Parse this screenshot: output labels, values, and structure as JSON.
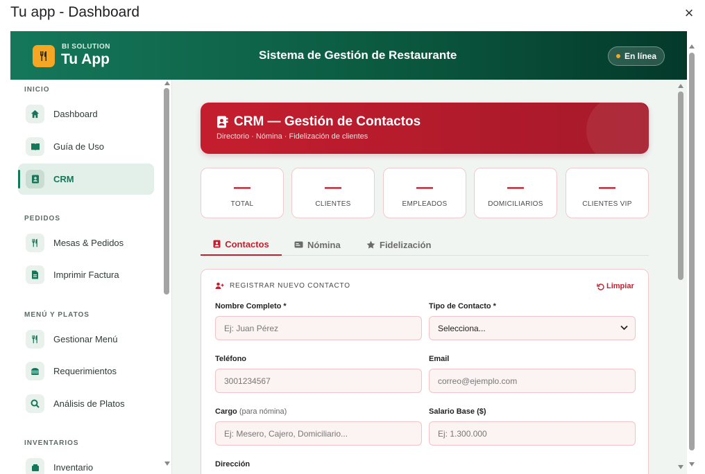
{
  "window": {
    "title": "Tu app - Dashboard",
    "close_icon": "×"
  },
  "header": {
    "brand_small": "BI SOLUTION",
    "brand_name": "Tu App",
    "title": "Sistema de Gestión de Restaurante",
    "status": "En línea"
  },
  "sidebar": {
    "sections": [
      "INICIO",
      "PEDIDOS",
      "MENÚ Y PLATOS",
      "INVENTARIOS"
    ],
    "items": [
      {
        "label": "Dashboard",
        "icon": "home-icon"
      },
      {
        "label": "Guía de Uso",
        "icon": "book-icon"
      },
      {
        "label": "CRM",
        "icon": "contact-card-icon"
      },
      {
        "label": "Mesas & Pedidos",
        "icon": "utensils-icon"
      },
      {
        "label": "Imprimir Factura",
        "icon": "document-icon"
      },
      {
        "label": "Gestionar Menú",
        "icon": "utensils-icon"
      },
      {
        "label": "Requerimientos",
        "icon": "burger-icon"
      },
      {
        "label": "Análisis de Platos",
        "icon": "magnify-icon"
      },
      {
        "label": "Inventario",
        "icon": "box-icon"
      }
    ]
  },
  "crm": {
    "title": "CRM — Gestión de Contactos",
    "subtitle": "Directorio · Nómina · Fidelización de clientes"
  },
  "stats": [
    {
      "value": "—",
      "label": "TOTAL"
    },
    {
      "value": "—",
      "label": "CLIENTES"
    },
    {
      "value": "—",
      "label": "EMPLEADOS"
    },
    {
      "value": "—",
      "label": "DOMICILIARIOS"
    },
    {
      "value": "—",
      "label": "CLIENTES VIP"
    }
  ],
  "tabs": [
    {
      "label": "Contactos",
      "active": true
    },
    {
      "label": "Nómina",
      "active": false
    },
    {
      "label": "Fidelización",
      "active": false
    }
  ],
  "form": {
    "section_title": "REGISTRAR NUEVO CONTACTO",
    "clear_label": "Limpiar",
    "fields": {
      "name": {
        "label": "Nombre Completo *",
        "placeholder": "Ej: Juan Pérez",
        "value": ""
      },
      "type": {
        "label": "Tipo de Contacto *",
        "selected": "Selecciona..."
      },
      "phone": {
        "label": "Teléfono",
        "placeholder": "3001234567",
        "value": ""
      },
      "email": {
        "label": "Email",
        "placeholder": "correo@ejemplo.com",
        "value": ""
      },
      "position": {
        "label": "Cargo",
        "hint": "(para nómina)",
        "placeholder": "Ej: Mesero, Cajero, Domiciliario...",
        "value": ""
      },
      "salary": {
        "label": "Salario Base ($)",
        "placeholder": "Ej: 1.300.000",
        "value": ""
      },
      "address": {
        "label": "Dirección"
      }
    }
  },
  "colors": {
    "brand_green": "#15775a",
    "crm_red": "#c41e2e",
    "accent_orange": "#f5a623"
  }
}
